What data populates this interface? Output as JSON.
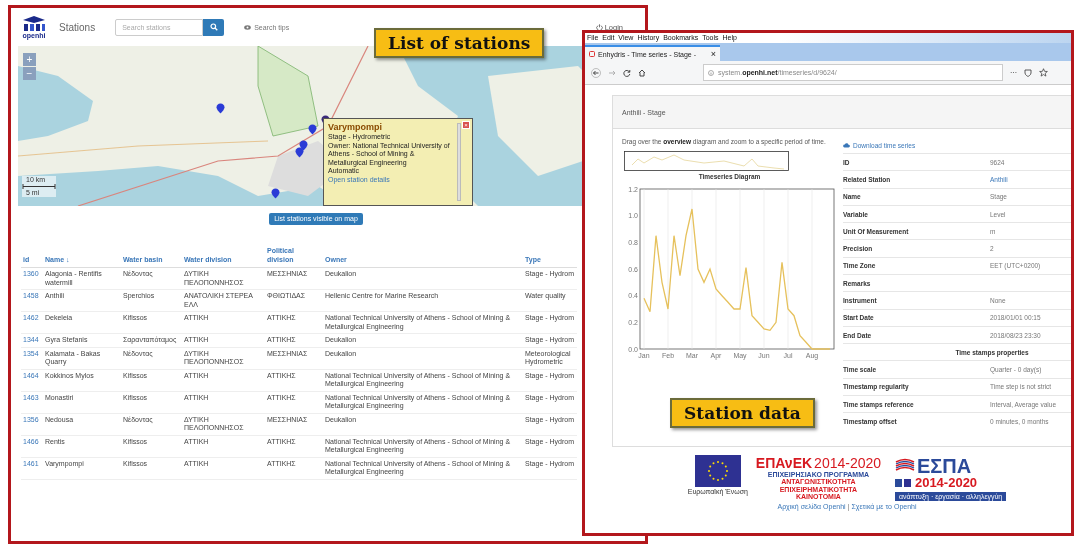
{
  "left_panel": {
    "logo_text": "openhi",
    "nav_title": "Stations",
    "search": {
      "placeholder": "Search stations"
    },
    "search_tips": "Search tips",
    "login": "Login",
    "callout": "List of stations",
    "map": {
      "zoom_in": "+",
      "zoom_out": "−",
      "scale": [
        "10 km",
        "5 mi"
      ],
      "popup": {
        "title": "Varympompi",
        "lines": [
          "Stage - Hydrometric",
          "Owner: National Technical University of Athens - School of Mining & Metallurgical Engineering",
          "Automatic"
        ],
        "link": "Open station details",
        "close": "×"
      }
    },
    "list_button": "List stations visible on map",
    "table": {
      "columns": [
        "id",
        "Name ↓",
        "Water basin",
        "Water division",
        "Political division",
        "Owner",
        "Type"
      ],
      "rows": [
        {
          "cells": [
            "1360",
            "Alagonia - Rentifis watermill",
            "Νέδοντας",
            "ΔΥΤΙΚΗ ΠΕΛΟΠΟΝΝΗΣΟΣ",
            "ΜΕΣΣΗΝΙΑΣ",
            "Deukalion",
            "Stage - Hydrom"
          ]
        },
        {
          "cells": [
            "1458",
            "Anthili",
            "Sperchios",
            "ΑΝΑΤΟΛΙΚΗ ΣΤΕΡΕΑ ΕΛΛ",
            "ΦΘΙΩΤΙΔΑΣ",
            "Hellenic Centre for Marine Research",
            "Water quality"
          ]
        },
        {
          "cells": [
            "1462",
            "Dekeleia",
            "Kifissos",
            "ΑΤΤΙΚΗ",
            "ΑΤΤΙΚΗΣ",
            "National Technical University of Athens - School of Mining & Metallurgical Engineering",
            "Stage - Hydrom"
          ]
        },
        {
          "cells": [
            "1344",
            "Gyra Stefanis",
            "Σαρανταπόταμος",
            "ΑΤΤΙΚΗ",
            "ΑΤΤΙΚΗΣ",
            "Deukalion",
            "Stage - Hydrom"
          ]
        },
        {
          "cells": [
            "1354",
            "Kalamata - Bakas Quarry",
            "Νέδοντας",
            "ΔΥΤΙΚΗ ΠΕΛΟΠΟΝΝΗΣΟΣ",
            "ΜΕΣΣΗΝΙΑΣ",
            "Deukalion",
            "Meteorological Hydrometric"
          ]
        },
        {
          "cells": [
            "1464",
            "Kokkinos Mylos",
            "Kifissos",
            "ΑΤΤΙΚΗ",
            "ΑΤΤΙΚΗΣ",
            "National Technical University of Athens - School of Mining & Metallurgical Engineering",
            "Stage - Hydrom"
          ]
        },
        {
          "cells": [
            "1463",
            "Monastiri",
            "Kifissos",
            "ΑΤΤΙΚΗ",
            "ΑΤΤΙΚΗΣ",
            "National Technical University of Athens - School of Mining & Metallurgical Engineering",
            "Stage - Hydrom"
          ]
        },
        {
          "cells": [
            "1356",
            "Nedousa",
            "Νέδοντας",
            "ΔΥΤΙΚΗ ΠΕΛΟΠΟΝΝΗΣΟΣ",
            "ΜΕΣΣΗΝΙΑΣ",
            "Deukalion",
            "Stage - Hydrom"
          ]
        },
        {
          "cells": [
            "1466",
            "Rentis",
            "Kifissos",
            "ΑΤΤΙΚΗ",
            "ΑΤΤΙΚΗΣ",
            "National Technical University of Athens - School of Mining & Metallurgical Engineering",
            "Stage - Hydrom"
          ]
        },
        {
          "cells": [
            "1461",
            "Varympompi",
            "Kifissos",
            "ΑΤΤΙΚΗ",
            "ΑΤΤΙΚΗΣ",
            "National Technical University of Athens - School of Mining & Metallurgical Engineering",
            "Stage - Hydrom"
          ]
        }
      ]
    }
  },
  "right_panel": {
    "menu": [
      "File",
      "Edit",
      "View",
      "History",
      "Bookmarks",
      "Tools",
      "Help"
    ],
    "tab": {
      "title": "Enhydris - Time series - Stage -",
      "close": "×"
    },
    "url": "system.**openhi.net**/timeseries/d/9624/",
    "url_more": "···",
    "callout": "Station data",
    "card": {
      "title": "Anthili - Stage",
      "intro": "Drag over the **overview** diagram and zoom to a specific period of time.",
      "download": "Download time series",
      "chart_title": "Timeseries Diagram",
      "chart_data": {
        "type": "line",
        "grid": true,
        "categories": [
          "Jan",
          null,
          null,
          null,
          "Feb",
          null,
          null,
          null,
          "Mar",
          null,
          null,
          null,
          "Apr",
          null,
          null,
          null,
          "May",
          null,
          null,
          null,
          "Jun",
          null,
          null,
          null,
          "Jul",
          null,
          null,
          null,
          "Aug",
          null,
          null,
          null
        ],
        "series": [
          {
            "color": "#e6c15c",
            "values": [
              0.38,
              0.28,
              0.85,
              0.5,
              0.3,
              0.85,
              0.55,
              0.85,
              1.05,
              0.6,
              0.5,
              0.6,
              0.45,
              0.4,
              0.35,
              0.3,
              0.3,
              0.61,
              0.25,
              0.2,
              0.15,
              0.14,
              0.2,
              0.65,
              0.3,
              0.25,
              0.1,
              0.05,
              0.0,
              0.0,
              0.0,
              0.0
            ]
          }
        ],
        "ylim": [
          0,
          1.2
        ],
        "yticks": [
          {
            "value": 0,
            "label": "0.0"
          },
          {
            "value": 0.2,
            "label": "0.2"
          },
          {
            "value": 0.4,
            "label": "0.4"
          },
          {
            "value": 0.6,
            "label": "0.6"
          },
          {
            "value": 0.8,
            "label": "0.8"
          },
          {
            "value": 1,
            "label": "1.0"
          },
          {
            "value": 1.2,
            "label": "1.2"
          }
        ]
      },
      "properties": [
        {
          "label": "ID",
          "value": "9624",
          "kind": "text"
        },
        {
          "label": "Related Station",
          "value": "Anthili",
          "kind": "link"
        },
        {
          "label": "Name",
          "value": "Stage",
          "kind": "text"
        },
        {
          "label": "Variable",
          "value": "Level",
          "kind": "text"
        },
        {
          "label": "Unit Of Measurement",
          "value": "m",
          "kind": "text"
        },
        {
          "label": "Precision",
          "value": "2",
          "kind": "text"
        },
        {
          "label": "Time Zone",
          "value": "EET (UTC+0200)",
          "kind": "text"
        },
        {
          "label": "Remarks"
        },
        {
          "label": "Instrument",
          "value": "None",
          "kind": "text"
        },
        {
          "label": "Start Date",
          "value": "2018/01/01 00:15",
          "kind": "text"
        },
        {
          "label": "End Date",
          "value": "2018/08/23 23:30",
          "kind": "text"
        }
      ],
      "section": "Time stamps properties",
      "timestamp_properties": [
        {
          "label": "Time scale",
          "value": "Quarter - 0 day(s)"
        },
        {
          "label": "Timestamp regularity",
          "value": "Time step is not strict"
        },
        {
          "label": "Time stamps reference",
          "value": "Interval, Average value"
        },
        {
          "label": "Timestamp offset",
          "value": "0 minutes, 0 months"
        }
      ]
    },
    "footer": {
      "eu_label": "Ευρωπαϊκή Ένωση",
      "epanek": {
        "name": "ΕΠΑνΕΚ",
        "years": "2014-2020",
        "program": "ΕΠΙΧΕΙΡΗΣΙΑΚΟ ΠΡΟΓΡΑΜΜΑ",
        "lines": [
          "ΑΝΤΑΓΩΝΙΣΤΙΚΟΤΗΤΑ",
          "ΕΠΙΧΕΙΡΗΜΑΤΙΚΟΤΗΤΑ",
          "ΚΑΙΝΟΤΟΜΙΑ"
        ]
      },
      "espa": {
        "name": "ΕΣΠΑ",
        "years": "2014-2020",
        "tagline": "ανάπτυξη · εργασία · αλληλεγγύη"
      },
      "links": [
        "Αρχική σελίδα Openhi",
        "Σχετικά με το Openhi"
      ],
      "separator": "|"
    }
  }
}
